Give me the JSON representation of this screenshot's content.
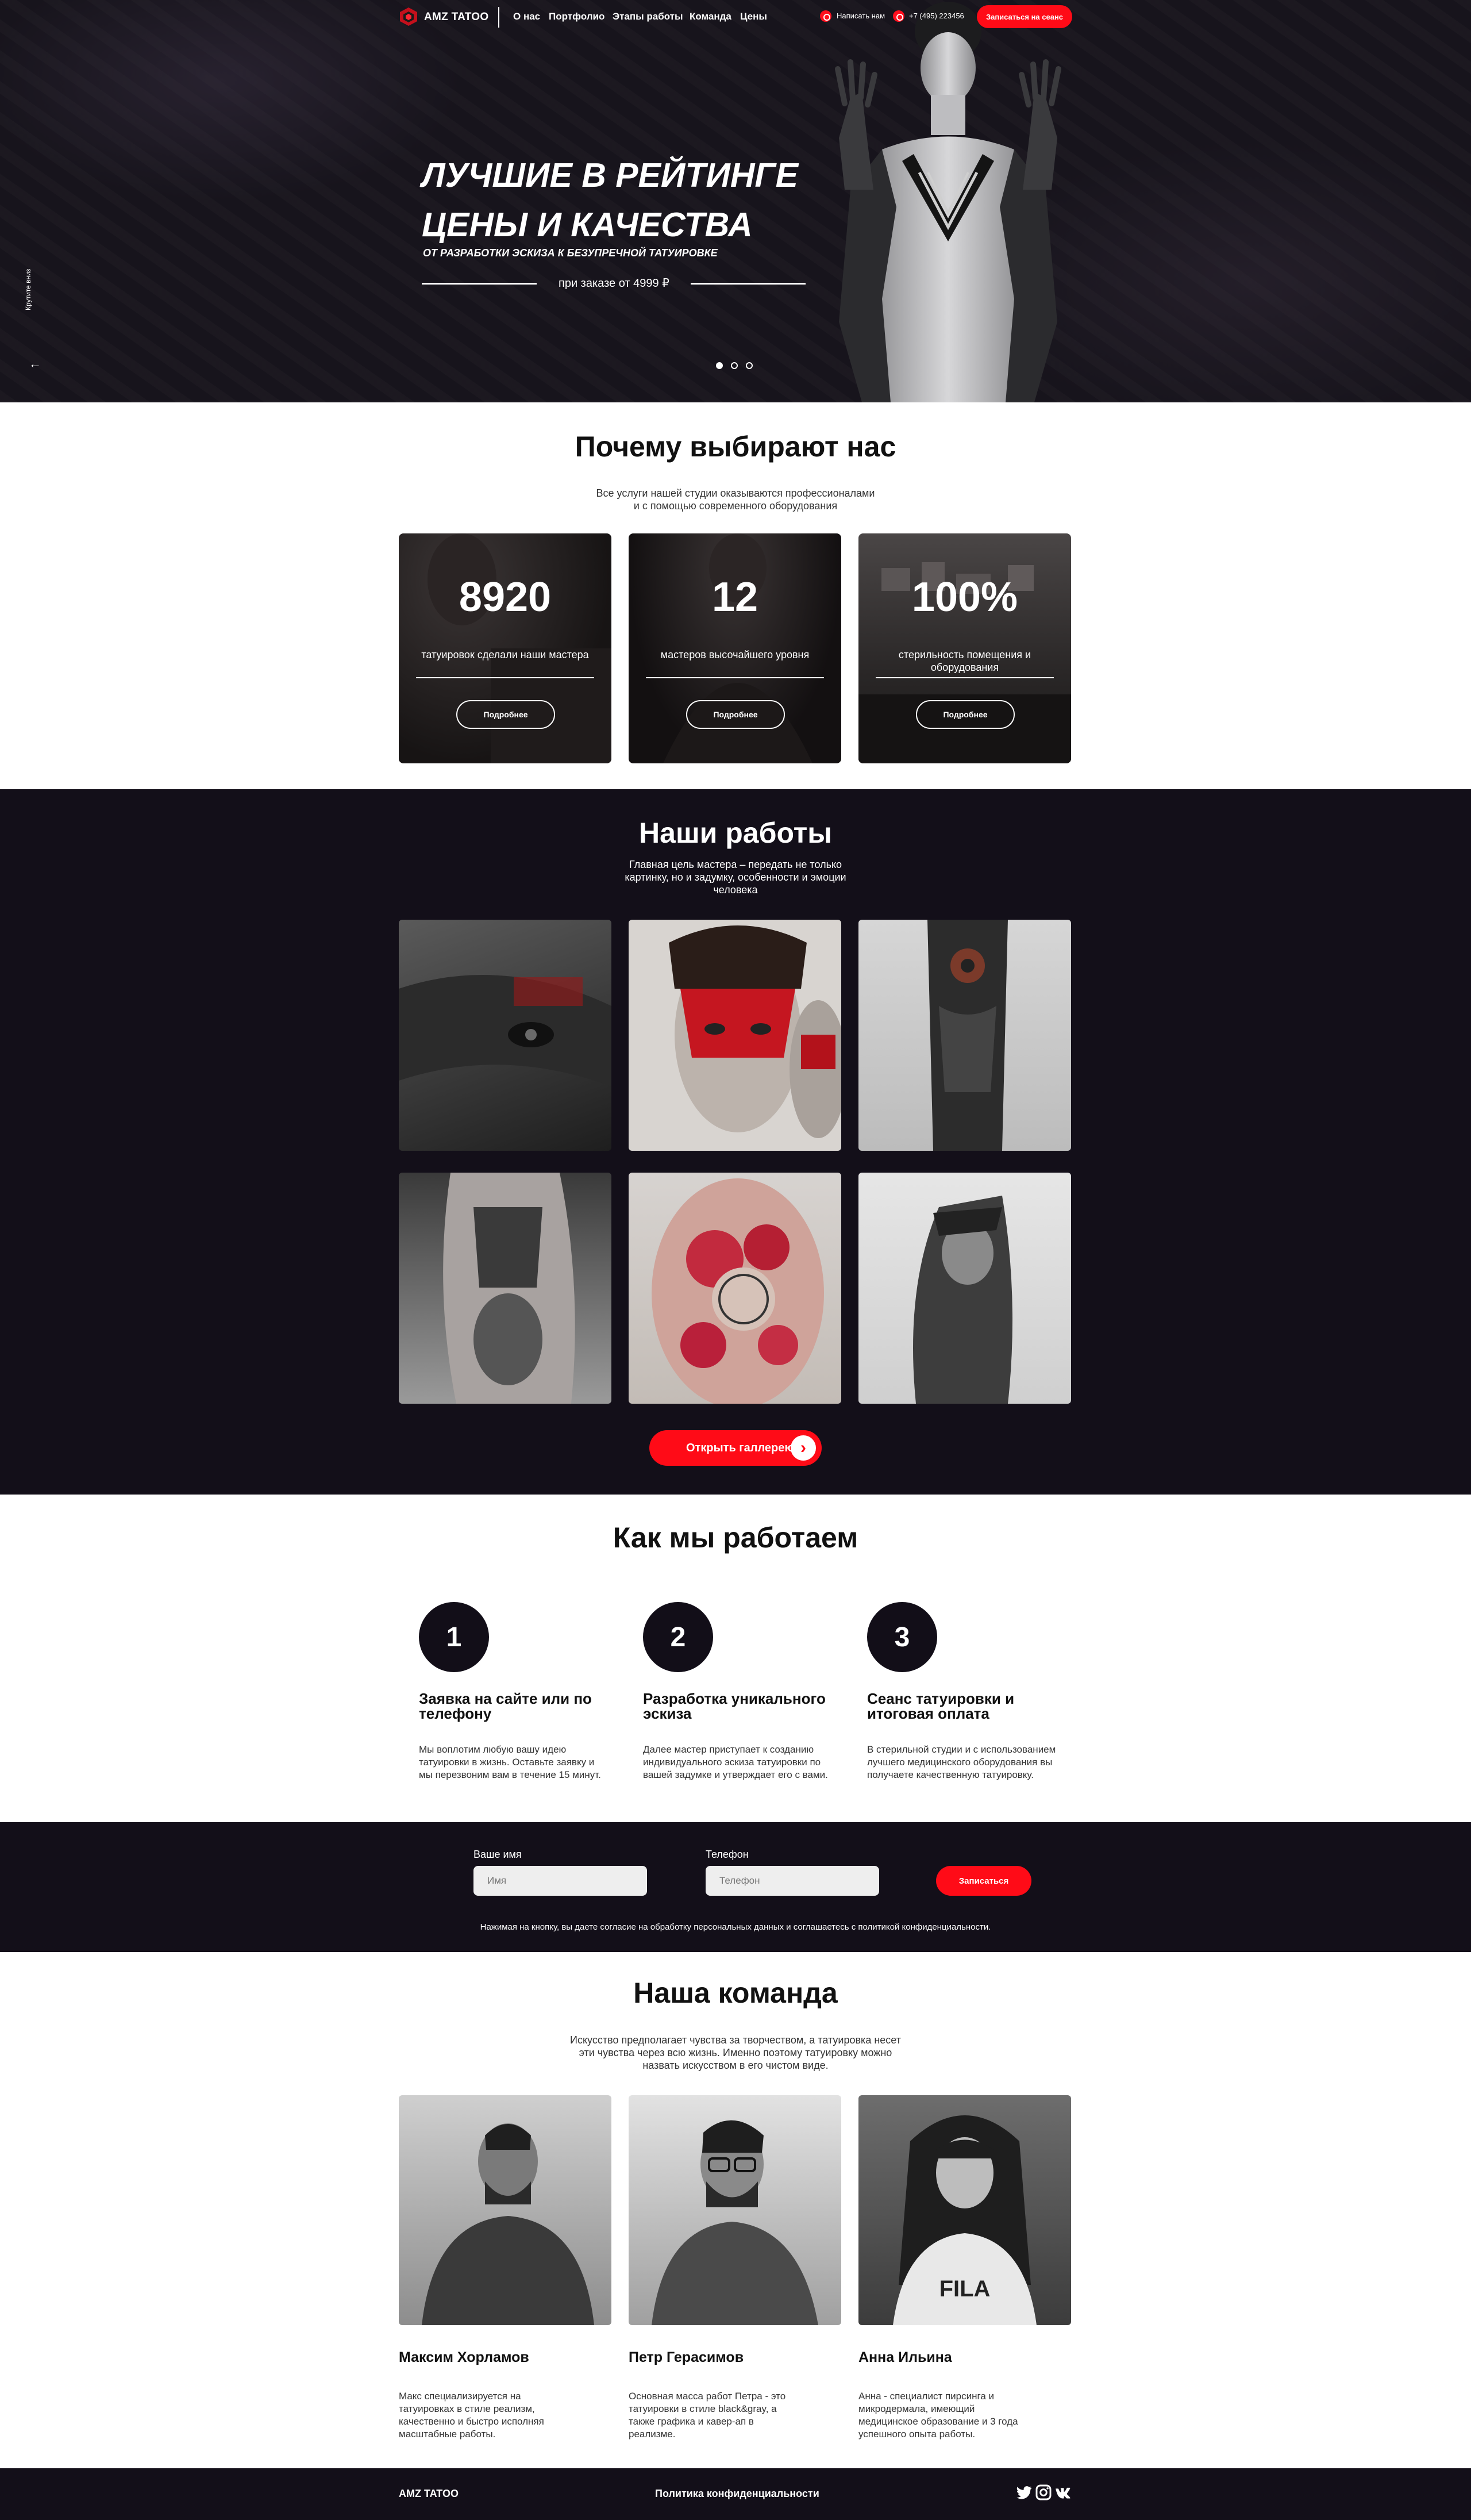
{
  "brand": {
    "name": "AMZ TATOO",
    "accent": "#ff0b17",
    "dark": "#130f19"
  },
  "nav": {
    "links": [
      "О нас",
      "Портфолио",
      "Этапы работы",
      "Команда",
      "Цены"
    ],
    "write_us": "Написать нам",
    "phone": "+7 (495) 223456",
    "cta": "Записаться на сеанс"
  },
  "hero": {
    "title_line1": "ЛУЧШИЕ В РЕЙТИНГЕ",
    "title_line2": "ЦЕНЫ И КАЧЕСТВА",
    "subtitle": "ОТ РАЗРАБОТКИ ЭСКИЗА К БЕЗУПРЕЧНОЙ ТАТУИРОВКЕ",
    "price": "при заказе от 4999 ₽",
    "side_link": "Крутите вниз",
    "slides_total": 3,
    "slide_active": 1
  },
  "why": {
    "title": "Почему выбирают нас",
    "lead_line1": "Все услуги нашей студии оказываются профессионалами",
    "lead_line2": "и с помощью современного оборудования",
    "cards": [
      {
        "number": "8920",
        "caption": "татуировок сделали наши мастера",
        "button": "Подробнее"
      },
      {
        "number": "12",
        "caption": "мастеров высочайшего уровня",
        "button": "Подробнее"
      },
      {
        "number": "100%",
        "caption": "стерильность помещения и оборудования",
        "button": "Подробнее"
      }
    ]
  },
  "works": {
    "title": "Наши работы",
    "lead_line1": "Главная цель мастера – передать не только",
    "lead_line2": "картинку, но и задумку, особенности и эмоции",
    "lead_line3": "человека",
    "gallery_button": "Открыть галлерею"
  },
  "steps": {
    "title": "Как мы работаем",
    "items": [
      {
        "num": "1",
        "title_line1": "Заявка на сайте или по",
        "title_line2": "телефону",
        "text": "Мы воплотим любую вашу идею татуировки в жизнь. Оставьте заявку и мы перезвоним вам в течение 15 минут."
      },
      {
        "num": "2",
        "title_line1": "Разработка уникального",
        "title_line2": "эскиза",
        "text": "Далее мастер приступает к созданию индивидуального эскиза татуировки по вашей задумке и утверждает его с вами."
      },
      {
        "num": "3",
        "title_line1": "Сеанс татуировки и",
        "title_line2": "итоговая оплата",
        "text": "В стерильной студии и с использованием лучшего медицинского оборудования вы получаете качественную татуировку."
      }
    ]
  },
  "form": {
    "name_label": "Ваше имя",
    "name_placeholder": "Имя",
    "phone_label": "Телефон",
    "phone_placeholder": "Телефон",
    "submit": "Записаться",
    "note": "Нажимая на кнопку, вы даете согласие на обработку персональных данных и соглашаетесь c политикой конфиденциальности."
  },
  "team": {
    "title": "Наша команда",
    "lead_line1": "Искусство предполагает чувства за творчеством, а татуировка несет",
    "lead_line2": "эти чувства через всю жизнь. Именно поэтому татуировку можно",
    "lead_line3": "назвать искусством в его чистом виде.",
    "members": [
      {
        "name": "Максим Хорламов",
        "bio": "Макс специализируется на татуировках в стиле реализм, качественно и быстро исполняя масштабные работы."
      },
      {
        "name": "Петр Герасимов",
        "bio": "Основная масса работ Петра - это татуировки в стиле black&gray, а также графика и кавер-ап в реализме."
      },
      {
        "name": "Анна Ильина",
        "bio": "Анна - специалист пирсинга и микродермала, имеющий медицинское образование и 3 года успешного опыта работы."
      }
    ]
  },
  "footer": {
    "logo": "AMZ TATOO",
    "policy": "Политика конфиденциальности",
    "socials": [
      "twitter-icon",
      "instagram-icon",
      "vk-icon"
    ]
  }
}
